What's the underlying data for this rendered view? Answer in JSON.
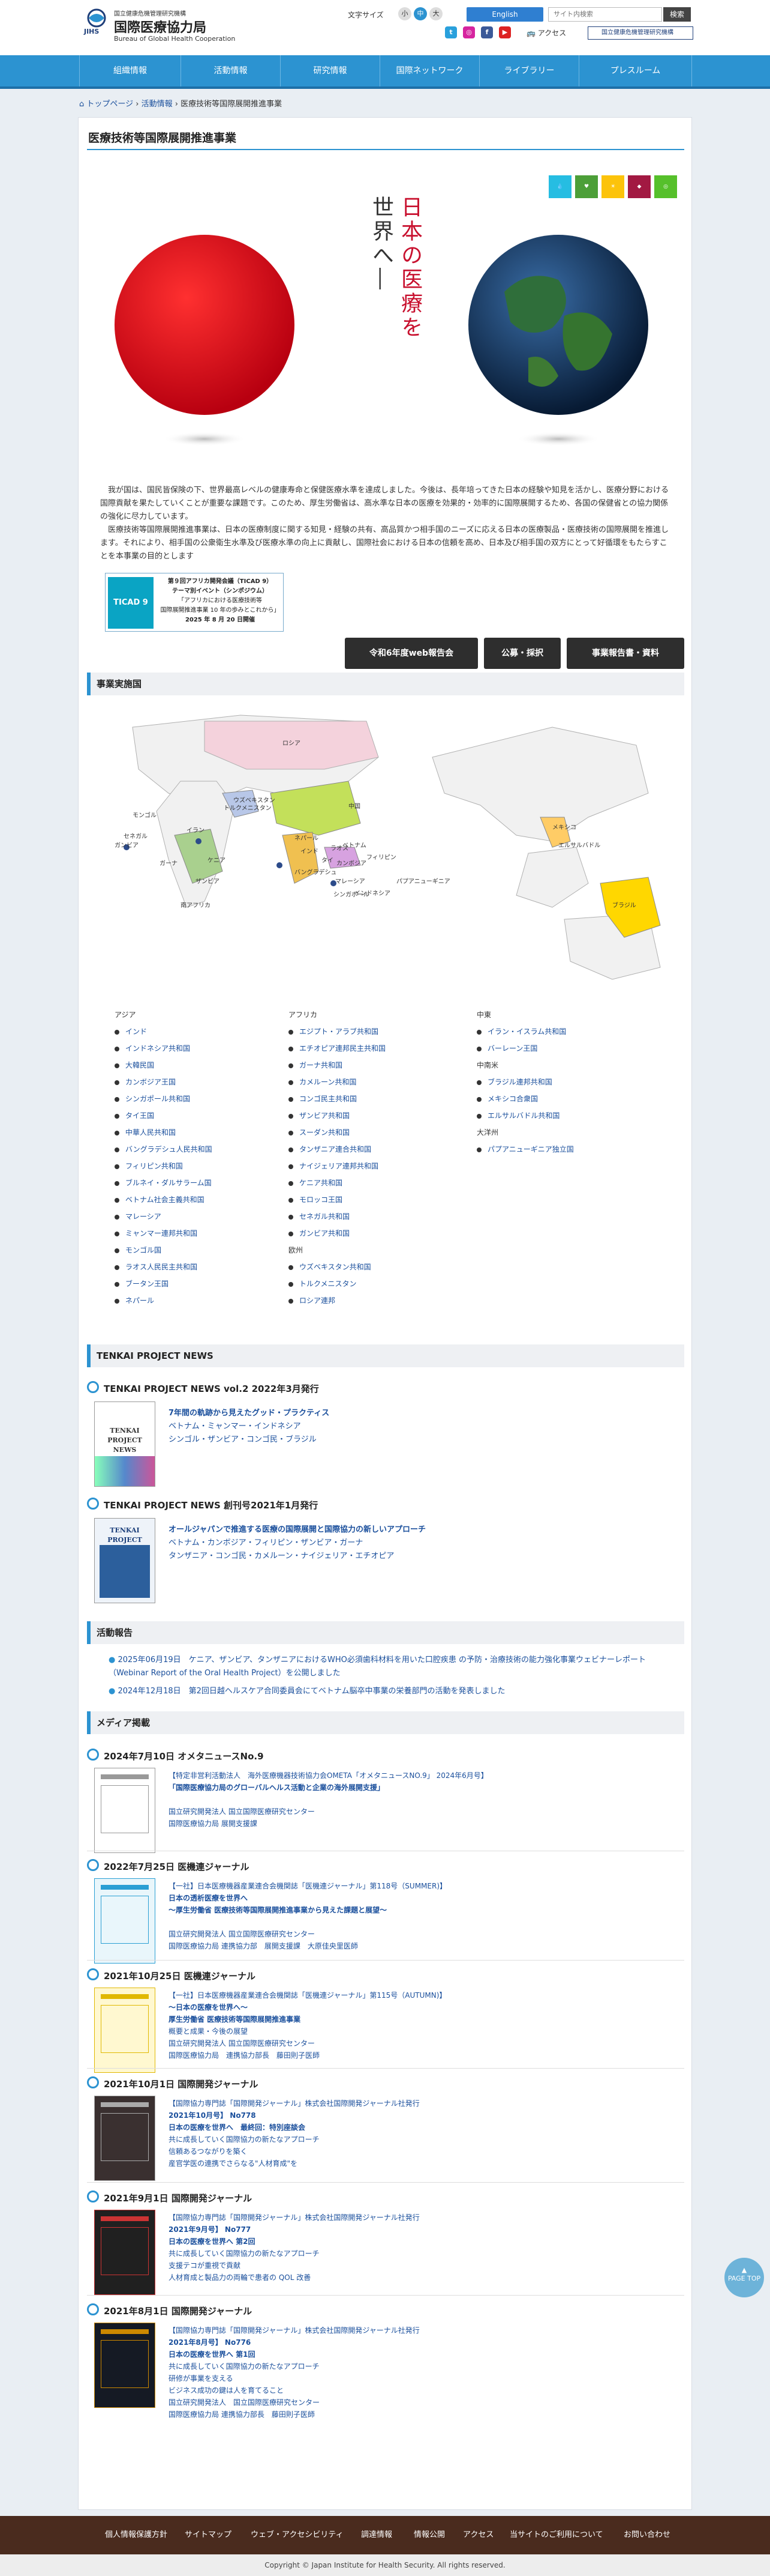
{
  "header": {
    "logo_tagline": "国立健康危機管理研究機構",
    "logo_mark": "JIHS",
    "logo_title": "国際医療協力局",
    "logo_subtitle": "Bureau of Global Health Cooperation",
    "font_size_label": "文字サイズ",
    "font_sizes": [
      "小",
      "中",
      "大"
    ],
    "english_label": "English",
    "search_placeholder": "サイト内検索",
    "search_button": "検索",
    "access_label": "アクセス",
    "ncgm_link": "国立健康危機管理研究機構"
  },
  "nav": {
    "items": [
      "組織情報",
      "活動情報",
      "研究情報",
      "国際ネットワーク",
      "ライブラリー",
      "プレスルーム"
    ]
  },
  "breadcrumb": {
    "items": [
      "トップページ",
      "活動情報",
      "医療技術等国際展開推進事業"
    ]
  },
  "page_title": "医療技術等国際展開推進事業",
  "hero": {
    "vertical_text": [
      "日本の医療を",
      "世界へ―"
    ]
  },
  "intro": {
    "p1": "我が国は、国民皆保険の下、世界最高レベルの健康寿命と保健医療水準を達成しました。今後は、長年培ってきた日本の経験や知見を活かし、医療分野における国際貢献を果たしていくことが重要な課題です。このため、厚生労働省は、高水準な日本の医療を効果的・効率的に国際展開するため、各国の保健省との協力関係の強化に尽力しています。",
    "p2": "医療技術等国際展開推進事業は、日本の医療制度に関する知見・経験の共有、高品質かつ相手国のニーズに応える日本の医療製品・医療技術の国際展開を推進します。それにより、相手国の公衆衛生水準及び医療水準の向上に貢献し、国際社会における日本の信頼を高め、日本及び相手国の双方にとって好循環をもたらすことを本事業の目的とします"
  },
  "ticad": {
    "line1": "第９回アフリカ開発会議（TICAD 9）",
    "line2": "テーマ別イベント（シンポジウム）",
    "line3": "「アフリカにおける医療技術等",
    "line4": "国際展開推進事業 10 年の歩みとこれから」",
    "line5": "2025 年 8 月 20 日開催",
    "badge": "TICAD 9"
  },
  "buttons": [
    "令和6年度web報告会",
    "公募・採択",
    "事業報告書・資料"
  ],
  "sections": {
    "countries": "事業実施国",
    "tenkai": "TENKAI PROJECT NEWS",
    "activity": "活動報告",
    "media": "メディア掲載"
  },
  "map_labels": [
    "ロシア",
    "モンゴル",
    "中国",
    "ウズベキスタン",
    "トルクメニスタン",
    "イラン",
    "インド",
    "ネパール",
    "ラオス",
    "ベトナム",
    "タイ",
    "カンボジア",
    "フィリピン",
    "マレーシア",
    "インドネシア",
    "パプアニューギニア",
    "シンガポール",
    "バングラデシュ",
    "ブラジル",
    "メキシコ",
    "エルサルバドル",
    "ガンビア",
    "セネガル",
    "ガーナ",
    "ケニア",
    "ザンビア",
    "南アフリカ"
  ],
  "country_list": {
    "asia_title": "アジア",
    "asia": [
      "インド",
      "インドネシア共和国",
      "大韓民国",
      "カンボジア王国",
      "シンガポール共和国",
      "タイ王国",
      "中華人民共和国",
      "バングラデシュ人民共和国",
      "フィリピン共和国",
      "ブルネイ・ダルサラーム国",
      "ベトナム社会主義共和国",
      "マレーシア",
      "ミャンマー連邦共和国",
      "モンゴル国",
      "ラオス人民民主共和国",
      "ブータン王国",
      "ネパール"
    ],
    "africa_title": "アフリカ",
    "africa": [
      "エジプト・アラブ共和国",
      "エチオピア連邦民主共和国",
      "ガーナ共和国",
      "カメルーン共和国",
      "コンゴ民主共和国",
      "ザンビア共和国",
      "スーダン共和国",
      "タンザニア連合共和国",
      "ナイジェリア連邦共和国",
      "ケニア共和国",
      "モロッコ王国",
      "セネガル共和国",
      "ガンビア共和国"
    ],
    "europe_title": "欧州",
    "europe": [
      "ウズベキスタン共和国",
      "トルクメニスタン",
      "ロシア連邦"
    ],
    "middle_east_title": "中東",
    "middle_east": [
      "イラン・イスラム共和国",
      "バーレーン王国"
    ],
    "latin_title": "中南米",
    "latin": [
      "ブラジル連邦共和国",
      "メキシコ合衆国",
      "エルサルバドル共和国"
    ],
    "oceania_title": "大洋州",
    "oceania": [
      "パプアニューギニア独立国"
    ]
  },
  "tenkai_news": [
    {
      "heading": "TENKAI PROJECT NEWS vol.2 2022年3月発行",
      "cover_title": "TENKAI PROJECT NEWS",
      "link": "7年間の軌跡から見えたグッド・プラクティス",
      "line2": "ベトナム・ミャンマー・インドネシア",
      "line3": "シンゴル・ザンビア・コンゴ民・ブラジル"
    },
    {
      "heading": "TENKAI PROJECT NEWS 創刊号2021年1月発行",
      "cover_title": "TENKAI PROJECT NEWS",
      "link": "オールジャパンで推進する医療の国際展開と国際協力の新しいアプローチ",
      "line2": "ベトナム・カンボジア・フィリピン・ザンビア・ガーナ",
      "line3": "タンザニア・コンゴ民・カメルーン・ナイジェリア・エチオピア"
    }
  ],
  "activity_reports": [
    "2025年06月19日　ケニア、ザンビア、タンザニアにおけるWHO必須歯科材料を用いた口腔疾患 の予防・治療技術の能力強化事業ウェビナーレポート（Webinar Report of the Oral Health Project）を公開しました",
    "2024年12月18日　第2回日越ヘルスケア合同委員会にてベトナム脳卒中事業の栄養部門の活動を発表しました"
  ],
  "media": [
    {
      "heading": "2024年7月10日 オメタニュースNo.9",
      "lines": [
        "【特定非営利活動法人　海外医療機器技術協力会OMETA「オメタニュースNO.9」 2024年6月号】",
        "「国際医療協力局のグローバルヘルス活動と企業の海外展開支援」",
        "",
        "国立研究開発法人 国立国際医療研究センター",
        "国際医療協力局 展開支援課"
      ]
    },
    {
      "heading": "2022年7月25日 医機連ジャーナル",
      "lines": [
        "【一社】日本医療機器産業連合会機関誌「医機連ジャーナル」第118号（SUMMER)】",
        "日本の透析医療を世界へ",
        "～厚生労働省 医療技術等国際展開推進事業から見えた課題と展望～",
        "",
        "国立研究開発法人 国立国際医療研究センター",
        "国際医療協力局 連携協力部　展開支援課　大原佳央里医師"
      ]
    },
    {
      "heading": "2021年10月25日 医機連ジャーナル",
      "lines": [
        "【一社】日本医療機器産業連合会機関誌「医機連ジャーナル」第115号（AUTUMN)】",
        "～日本の医療を世界へ～",
        "厚生労働省 医療技術等国際展開推進事業",
        "概要と成果・今後の展望",
        "国立研究開発法人 国立国際医療研究センター",
        "国際医療協力局　連携協力部長　藤田則子医師"
      ]
    },
    {
      "heading": "2021年10月1日 国際開発ジャーナル",
      "lines": [
        "【国際協力専門誌「国際開発ジャーナル」株式会社国際開発ジャーナル社発行",
        "2021年10月号】 No778",
        "日本の医療を世界へ　最終回：特別座談会",
        "共に成長していく国際協力の新たなアプローチ",
        "信頼あるつながりを築く",
        "産官学医の連携でさらなる\"人材育成\"を"
      ]
    },
    {
      "heading": "2021年9月1日 国際開発ジャーナル",
      "lines": [
        "【国際協力専門誌「国際開発ジャーナル」株式会社国際開発ジャーナル社発行",
        "2021年9月号】 No777",
        "日本の医療を世界へ 第2回",
        "共に成長していく国際協力の新たなアプローチ",
        "支援テコが重視で貢献",
        "人材育成と製品力の両輪で患者の QOL 改善"
      ]
    },
    {
      "heading": "2021年8月1日 国際開発ジャーナル",
      "lines": [
        "【国際協力専門誌「国際開発ジャーナル」株式会社国際開発ジャーナル社発行",
        "2021年8月号】 No776",
        "日本の医療を世界へ 第1回",
        "共に成長していく国際協力の新たなアプローチ",
        "研修が事業を支える",
        "ビジネス成功の鍵は人を育てること",
        "国立研究開発法人　国立国際医療研究センター",
        "国際医療協力局 連携協力部長　藤田則子医師"
      ]
    }
  ],
  "footer": {
    "links": [
      "個人情報保護方針",
      "サイトマップ",
      "ウェブ・アクセシビリティ",
      "調達情報",
      "情報公開",
      "アクセス",
      "当サイトのご利用について",
      "お問い合わせ"
    ],
    "copyright": "Copyright © Japan Institute for Health Security. All rights reserved."
  },
  "pagetop": "PAGE TOP",
  "colors": {
    "nav": "#2c93d1",
    "footer": "#4a2b1e",
    "accent": "#2c93d1",
    "red": "#d7141a"
  }
}
